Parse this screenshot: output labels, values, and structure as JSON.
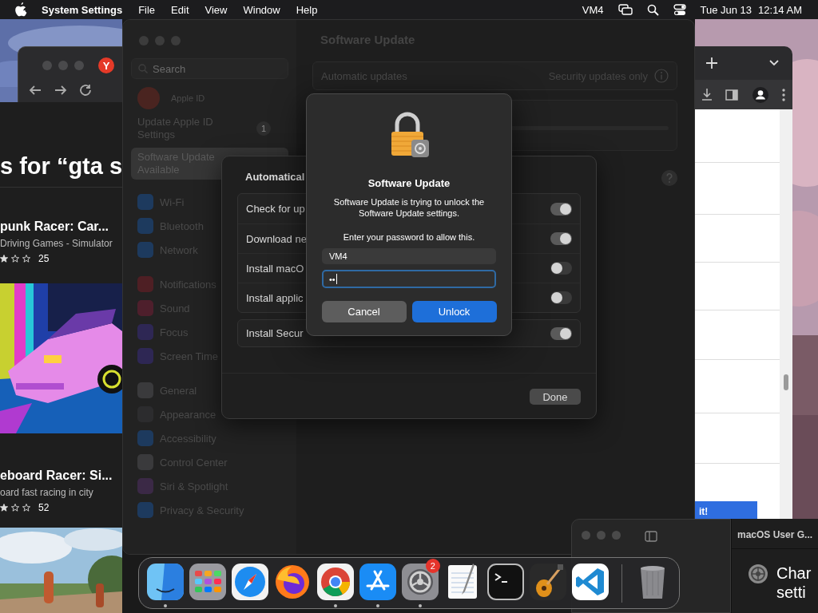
{
  "menu_bar": {
    "app": "System Settings",
    "menus": [
      "File",
      "Edit",
      "View",
      "Window",
      "Help"
    ],
    "user": "VM4",
    "date": "Tue Jun 13",
    "time": "12:14 AM"
  },
  "browser_left": {
    "tab_logo": "Y"
  },
  "app_store": {
    "heading": "s for “gta s",
    "games": [
      {
        "title": "punk Racer: Car...",
        "subtitle": "Driving Games - Simulator",
        "stars": 1,
        "count": "25"
      },
      {
        "title": "eboard Racer: Si...",
        "subtitle": "oard fast racing in city",
        "stars": 1,
        "count": "52"
      }
    ]
  },
  "browser_right": {
    "button": "it!"
  },
  "settings": {
    "search": {
      "placeholder": "Search"
    },
    "sidebar": {
      "account": "Apple ID",
      "items": [
        {
          "label": "Update Apple ID Settings",
          "badge": "1",
          "selected": false
        },
        {
          "label": "Software Update Available",
          "selected": true
        }
      ],
      "groups": [
        {
          "items": [
            {
              "label": "Wi-Fi",
              "color": "#1d3a5e"
            },
            {
              "label": "Bluetooth",
              "color": "#1d3a5e"
            },
            {
              "label": "Network",
              "color": "#1d3a5e"
            }
          ]
        },
        {
          "items": [
            {
              "label": "Notifications",
              "color": "#4e1f24"
            },
            {
              "label": "Sound",
              "color": "#4e1f2c"
            },
            {
              "label": "Focus",
              "color": "#2e2754"
            },
            {
              "label": "Screen Time",
              "color": "#2e2754"
            }
          ]
        },
        {
          "items": [
            {
              "label": "General",
              "color": "#3a3a3c"
            },
            {
              "label": "Appearance",
              "color": "#2c2c2e"
            },
            {
              "label": "Accessibility",
              "color": "#1d3a5e"
            },
            {
              "label": "Control Center",
              "color": "#3a3a3c"
            },
            {
              "label": "Siri & Spotlight",
              "color": "#3b2946"
            },
            {
              "label": "Privacy & Security",
              "color": "#1d3a5e"
            }
          ]
        }
      ]
    },
    "title": "Software Update",
    "automatic_updates": {
      "label": "Automatic updates",
      "value": "Security updates only"
    }
  },
  "sheet": {
    "title": "Automatical",
    "options": [
      {
        "label": "Check for up",
        "on": true
      },
      {
        "label": "Download ne",
        "on": true
      },
      {
        "label": "Install macO",
        "on": false
      },
      {
        "label": "Install applic",
        "on": false
      },
      {
        "label": "Install Secur",
        "on": true
      }
    ],
    "done": "Done"
  },
  "auth_dialog": {
    "title": "Software Update",
    "message": "Software Update is trying to unlock the Software Update settings.",
    "prompt": "Enter your password to allow this.",
    "username": "VM4",
    "password": "••",
    "buttons": [
      {
        "label": "Cancel",
        "kind": "secondary"
      },
      {
        "label": "Unlock",
        "kind": "default"
      }
    ]
  },
  "user_guide": {
    "title": "macOS User G...",
    "heading": "Char",
    "subheading": "setti"
  },
  "dock": {
    "apps": [
      {
        "kind": "finder",
        "running": true
      },
      {
        "kind": "launchpad",
        "running": false
      },
      {
        "kind": "safari",
        "running": false
      },
      {
        "kind": "firefox",
        "running": false
      },
      {
        "kind": "chrome",
        "running": true
      },
      {
        "kind": "appstore",
        "running": true
      },
      {
        "kind": "settings",
        "running": true,
        "badge": "2"
      },
      {
        "kind": "textedit",
        "running": false
      },
      {
        "kind": "terminal",
        "running": false
      },
      {
        "kind": "garageband",
        "running": false
      },
      {
        "kind": "vscode",
        "running": false
      },
      {
        "kind": "trash",
        "running": false
      }
    ]
  }
}
